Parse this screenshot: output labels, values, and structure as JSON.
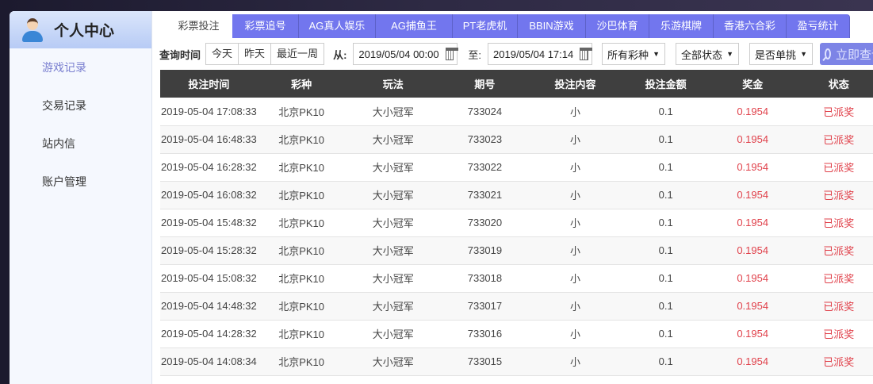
{
  "sidebar": {
    "title": "个人中心",
    "items": [
      {
        "label": "游戏记录",
        "active": true
      },
      {
        "label": "交易记录"
      },
      {
        "label": "站内信"
      },
      {
        "label": "账户管理"
      }
    ]
  },
  "tabs": [
    "彩票投注",
    "彩票追号",
    "AG真人娱乐",
    "AG捕鱼王",
    "PT老虎机",
    "BBIN游戏",
    "沙巴体育",
    "乐游棋牌",
    "香港六合彩",
    "盈亏统计"
  ],
  "filter": {
    "label": "查询时间",
    "quick": [
      "今天",
      "昨天",
      "最近一周"
    ],
    "from_label": "从:",
    "from": "2019/05/04 00:00",
    "to_label": "至:",
    "to": "2019/05/04 17:14",
    "lottery": "所有彩种",
    "status": "全部状态",
    "single": "是否单挑",
    "search": "立即查询"
  },
  "colors": {
    "accent": "#7276ee",
    "red": "#e0404a"
  },
  "table": {
    "headers": [
      "投注时间",
      "彩种",
      "玩法",
      "期号",
      "投注内容",
      "投注金额",
      "奖金",
      "状态"
    ],
    "rows": [
      [
        "2019-05-04 17:08:33",
        "北京PK10",
        "大小冠军",
        "733024",
        "小",
        "0.1",
        "0.1954",
        "已派奖"
      ],
      [
        "2019-05-04 16:48:33",
        "北京PK10",
        "大小冠军",
        "733023",
        "小",
        "0.1",
        "0.1954",
        "已派奖"
      ],
      [
        "2019-05-04 16:28:32",
        "北京PK10",
        "大小冠军",
        "733022",
        "小",
        "0.1",
        "0.1954",
        "已派奖"
      ],
      [
        "2019-05-04 16:08:32",
        "北京PK10",
        "大小冠军",
        "733021",
        "小",
        "0.1",
        "0.1954",
        "已派奖"
      ],
      [
        "2019-05-04 15:48:32",
        "北京PK10",
        "大小冠军",
        "733020",
        "小",
        "0.1",
        "0.1954",
        "已派奖"
      ],
      [
        "2019-05-04 15:28:32",
        "北京PK10",
        "大小冠军",
        "733019",
        "小",
        "0.1",
        "0.1954",
        "已派奖"
      ],
      [
        "2019-05-04 15:08:32",
        "北京PK10",
        "大小冠军",
        "733018",
        "小",
        "0.1",
        "0.1954",
        "已派奖"
      ],
      [
        "2019-05-04 14:48:32",
        "北京PK10",
        "大小冠军",
        "733017",
        "小",
        "0.1",
        "0.1954",
        "已派奖"
      ],
      [
        "2019-05-04 14:28:32",
        "北京PK10",
        "大小冠军",
        "733016",
        "小",
        "0.1",
        "0.1954",
        "已派奖"
      ],
      [
        "2019-05-04 14:08:34",
        "北京PK10",
        "大小冠军",
        "733015",
        "小",
        "0.1",
        "0.1954",
        "已派奖"
      ]
    ]
  }
}
